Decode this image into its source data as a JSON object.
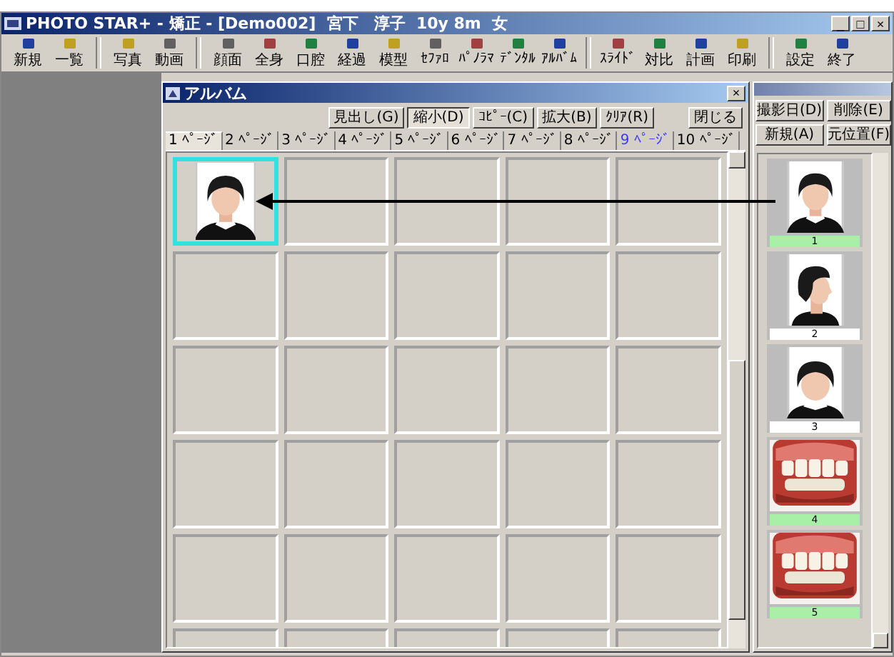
{
  "window": {
    "title": "PHOTO STAR+ - 矯正 - [Demo002]  宮下　淳子  10y 8m  女",
    "controls": [
      "_",
      "□",
      "×"
    ]
  },
  "toolbar": [
    [
      {
        "label": "新規"
      },
      {
        "label": "一覧"
      }
    ],
    [
      {
        "label": "写真"
      },
      {
        "label": "動画"
      }
    ],
    [
      {
        "label": "顔面"
      },
      {
        "label": "全身"
      },
      {
        "label": "口腔"
      },
      {
        "label": "経過"
      },
      {
        "label": "模型"
      },
      {
        "label": "ｾﾌｧﾛ"
      },
      {
        "label": "ﾊﾟﾉﾗﾏ"
      },
      {
        "label": "ﾃﾞﾝﾀﾙ"
      },
      {
        "label": "ｱﾙﾊﾞﾑ"
      }
    ],
    [
      {
        "label": "ｽﾗｲﾄﾞ"
      },
      {
        "label": "対比"
      },
      {
        "label": "計画"
      },
      {
        "label": "印刷"
      }
    ],
    [
      {
        "label": "設定"
      },
      {
        "label": "終了"
      }
    ]
  ],
  "album": {
    "title": "アルバム",
    "close": "×",
    "buttons": [
      {
        "label": "見出し(G)",
        "pressed": false
      },
      {
        "label": "縮小(D)",
        "pressed": true
      },
      {
        "label": "ｺﾋﾟｰ(C)",
        "pressed": false
      },
      {
        "label": "拡大(B)",
        "pressed": false
      },
      {
        "label": "ｸﾘｱ(R)",
        "pressed": false
      }
    ],
    "close_button": "閉じる",
    "tabs": [
      {
        "label": "1 ﾍﾟｰｼﾞ",
        "selected": true,
        "highlighted": false
      },
      {
        "label": "2 ﾍﾟｰｼﾞ",
        "selected": false,
        "highlighted": false
      },
      {
        "label": "3 ﾍﾟｰｼﾞ",
        "selected": false,
        "highlighted": false
      },
      {
        "label": "4 ﾍﾟｰｼﾞ",
        "selected": false,
        "highlighted": false
      },
      {
        "label": "5 ﾍﾟｰｼﾞ",
        "selected": false,
        "highlighted": false
      },
      {
        "label": "6 ﾍﾟｰｼﾞ",
        "selected": false,
        "highlighted": false
      },
      {
        "label": "7 ﾍﾟｰｼﾞ",
        "selected": false,
        "highlighted": false
      },
      {
        "label": "8 ﾍﾟｰｼﾞ",
        "selected": false,
        "highlighted": false
      },
      {
        "label": "9 ﾍﾟｰｼﾞ",
        "selected": false,
        "highlighted": true
      },
      {
        "label": "10 ﾍﾟｰｼﾞ",
        "selected": false,
        "highlighted": false
      }
    ],
    "cells": [
      {
        "kind": "face-front",
        "selected": true
      },
      {
        "kind": "empty",
        "selected": false
      },
      {
        "kind": "empty",
        "selected": false
      },
      {
        "kind": "empty",
        "selected": false
      },
      {
        "kind": "empty",
        "selected": false
      },
      {
        "kind": "empty",
        "selected": false
      },
      {
        "kind": "empty",
        "selected": false
      },
      {
        "kind": "empty",
        "selected": false
      },
      {
        "kind": "empty",
        "selected": false
      },
      {
        "kind": "empty",
        "selected": false
      },
      {
        "kind": "empty",
        "selected": false
      },
      {
        "kind": "empty",
        "selected": false
      },
      {
        "kind": "empty",
        "selected": false
      },
      {
        "kind": "empty",
        "selected": false
      },
      {
        "kind": "empty",
        "selected": false
      },
      {
        "kind": "empty",
        "selected": false
      },
      {
        "kind": "empty",
        "selected": false
      },
      {
        "kind": "empty",
        "selected": false
      },
      {
        "kind": "empty",
        "selected": false
      },
      {
        "kind": "empty",
        "selected": false
      },
      {
        "kind": "empty",
        "selected": false
      },
      {
        "kind": "empty",
        "selected": false
      },
      {
        "kind": "empty",
        "selected": false
      },
      {
        "kind": "empty",
        "selected": false
      },
      {
        "kind": "empty",
        "selected": false
      },
      {
        "kind": "empty",
        "selected": false
      },
      {
        "kind": "empty",
        "selected": false
      },
      {
        "kind": "empty",
        "selected": false
      },
      {
        "kind": "empty",
        "selected": false
      },
      {
        "kind": "empty",
        "selected": false
      }
    ]
  },
  "thumbnails": {
    "buttons": [
      "撮影日(D)",
      "削除(E)",
      "新規(A)",
      "元位置(F)"
    ],
    "items": [
      {
        "kind": "face-front",
        "label": "1",
        "marked": true
      },
      {
        "kind": "face-side",
        "label": "2",
        "marked": false
      },
      {
        "kind": "face-smile",
        "label": "3",
        "marked": false
      },
      {
        "kind": "teeth",
        "label": "4",
        "marked": true
      },
      {
        "kind": "teeth",
        "label": "5",
        "marked": true
      }
    ]
  }
}
